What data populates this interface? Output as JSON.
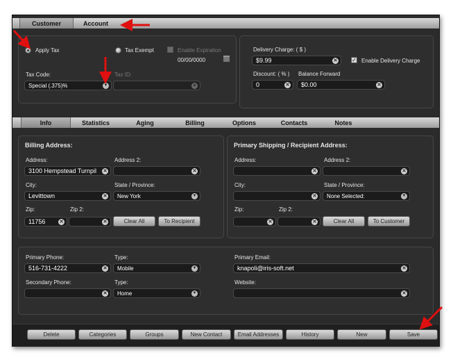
{
  "top_tabs": [
    "Customer",
    "Account"
  ],
  "tax": {
    "apply_tax": "Apply Tax",
    "tax_exempt": "Tax Exempt",
    "enable_expiration": "Enable Expiration",
    "expiration_date": "00/00/0000",
    "tax_code_label": "Tax Code:",
    "tax_code_value": "Special (.375)%",
    "tax_id_label": "Tax ID:"
  },
  "delivery": {
    "delivery_charge_label": "Delivery Charge: ( $ )",
    "delivery_charge_value": "$9.99",
    "enable_delivery_charge": "Enable Delivery Charge",
    "discount_label": "Discount: ( % )",
    "discount_value": "0",
    "balance_forward_label": "Balance Forward",
    "balance_forward_value": "$0.00"
  },
  "section_tabs": [
    "Info",
    "Statistics",
    "Aging",
    "Billing",
    "Options",
    "Contacts",
    "Notes"
  ],
  "billing": {
    "title": "Billing Address:",
    "address_label": "Address:",
    "address_value": "3100 Hempstead Turnpil",
    "address2_label": "Address 2:",
    "city_label": "City:",
    "city_value": "Levittown",
    "state_label": "State / Province:",
    "state_value": "New York",
    "zip_label": "Zip:",
    "zip_value": "11756",
    "zip2_label": "Zip 2:",
    "clear_all": "Clear All",
    "to_recipient": "To Recipient"
  },
  "shipping": {
    "title": "Primary Shipping / Recipient Address:",
    "address_label": "Address:",
    "address2_label": "Address 2:",
    "city_label": "City:",
    "state_label": "State / Province:",
    "state_value": "None Selected:",
    "zip_label": "Zip:",
    "zip2_label": "Zip 2:",
    "clear_all": "Clear All",
    "to_customer": "To Customer"
  },
  "contact": {
    "primary_phone_label": "Primary Phone:",
    "primary_phone_value": "516-731-4222",
    "type_label": "Type:",
    "type1_value": "Mobile",
    "secondary_phone_label": "Secondary Phone:",
    "type2_label": "Type:",
    "type2_value": "Home",
    "primary_email_label": "Primary Email:",
    "primary_email_value": "knapoli@iris-soft.net",
    "website_label": "Website:"
  },
  "bottom_buttons": [
    "Delete",
    "Categories",
    "Groups",
    "New Contact",
    "Email Addresses",
    "History",
    "New",
    "Save"
  ],
  "colors": {
    "annotation_arrow": "#e01010",
    "background": "#2b2b2b"
  }
}
